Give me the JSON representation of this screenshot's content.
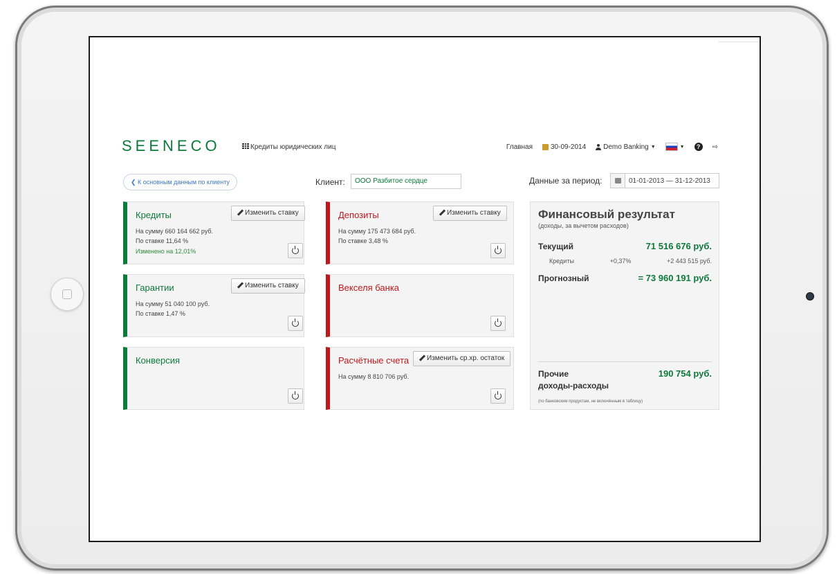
{
  "header": {
    "logo": "SEENECO",
    "section": "Кредиты юридических лиц",
    "nav_home": "Главная",
    "date": "30-09-2014",
    "user": "Demo Banking"
  },
  "toolbar": {
    "back_label": "К основным данным по клиенту",
    "client_label": "Клиент:",
    "client_value": "ООО Разбитое сердце",
    "period_label": "Данные за период:",
    "period_value": "01-01-2013 — 31-12-2013"
  },
  "cards": {
    "credits": {
      "title": "Кредиты",
      "edit": "Изменить ставку",
      "line1": "На сумму 660 164 662 руб.",
      "line2": "По ставке 11,64 %",
      "line3": "Изменено на 12,01%"
    },
    "deposits": {
      "title": "Депозиты",
      "edit": "Изменить ставку",
      "line1": "На сумму 175 473 684 руб.",
      "line2": "По ставке 3,48 %"
    },
    "guarantees": {
      "title": "Гарантии",
      "edit": "Изменить ставку",
      "line1": "На сумму 51 040 100 руб.",
      "line2": "По ставке 1,47 %"
    },
    "bills": {
      "title": "Векселя банка"
    },
    "conversion": {
      "title": "Конверсия"
    },
    "accounts": {
      "title": "Расчётные счета",
      "edit": "Изменить ср.хр. остаток",
      "line1": "На сумму 8 810 706 руб."
    }
  },
  "finance": {
    "title": "Финансовый результат",
    "subtitle": "(доходы, за вычетом расходов)",
    "current_label": "Текущий",
    "current_value": "71 516 676 руб.",
    "credits_label": "Кредиты",
    "credits_pct": "+0,37%",
    "credits_value": "+2 443 515 руб.",
    "forecast_label": "Прогнозный",
    "forecast_value": "= 73 960 191 руб.",
    "other_label_1": "Прочие",
    "other_label_2": "доходы-расходы",
    "other_value": "190 754 руб.",
    "footnote": "(по банковским продуктам, не включённым в таблицу)"
  }
}
